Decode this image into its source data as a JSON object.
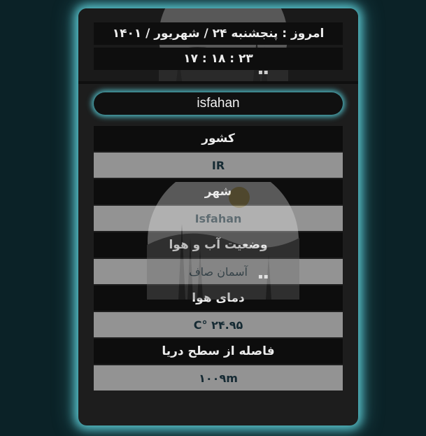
{
  "header": {
    "date_line": "امروز : پنجشنبه ۲۴ / شهریور / ۱۴۰۱",
    "time_line": "۲۳ : ۱۸ : ۱۷"
  },
  "search": {
    "value": "isfahan"
  },
  "weather": {
    "country_label": "کشور",
    "country_value": "IR",
    "city_label": "شهر",
    "city_value": "Isfahan",
    "condition_label": "وضعیت آب و هوا",
    "condition_value": "آسمان صاف",
    "temp_label": "دمای هوا",
    "temp_value": "۲۴.۹۵ °C",
    "sea_level_label": "فاصله از سطح دریا",
    "sea_level_value": "۱۰۰۹m"
  },
  "colors": {
    "page_bg": "#0b2227",
    "glow": "#58c3cc",
    "card_bg": "#1d1d1d",
    "label_row": "#0d0d0d",
    "value_row": "#939393"
  }
}
